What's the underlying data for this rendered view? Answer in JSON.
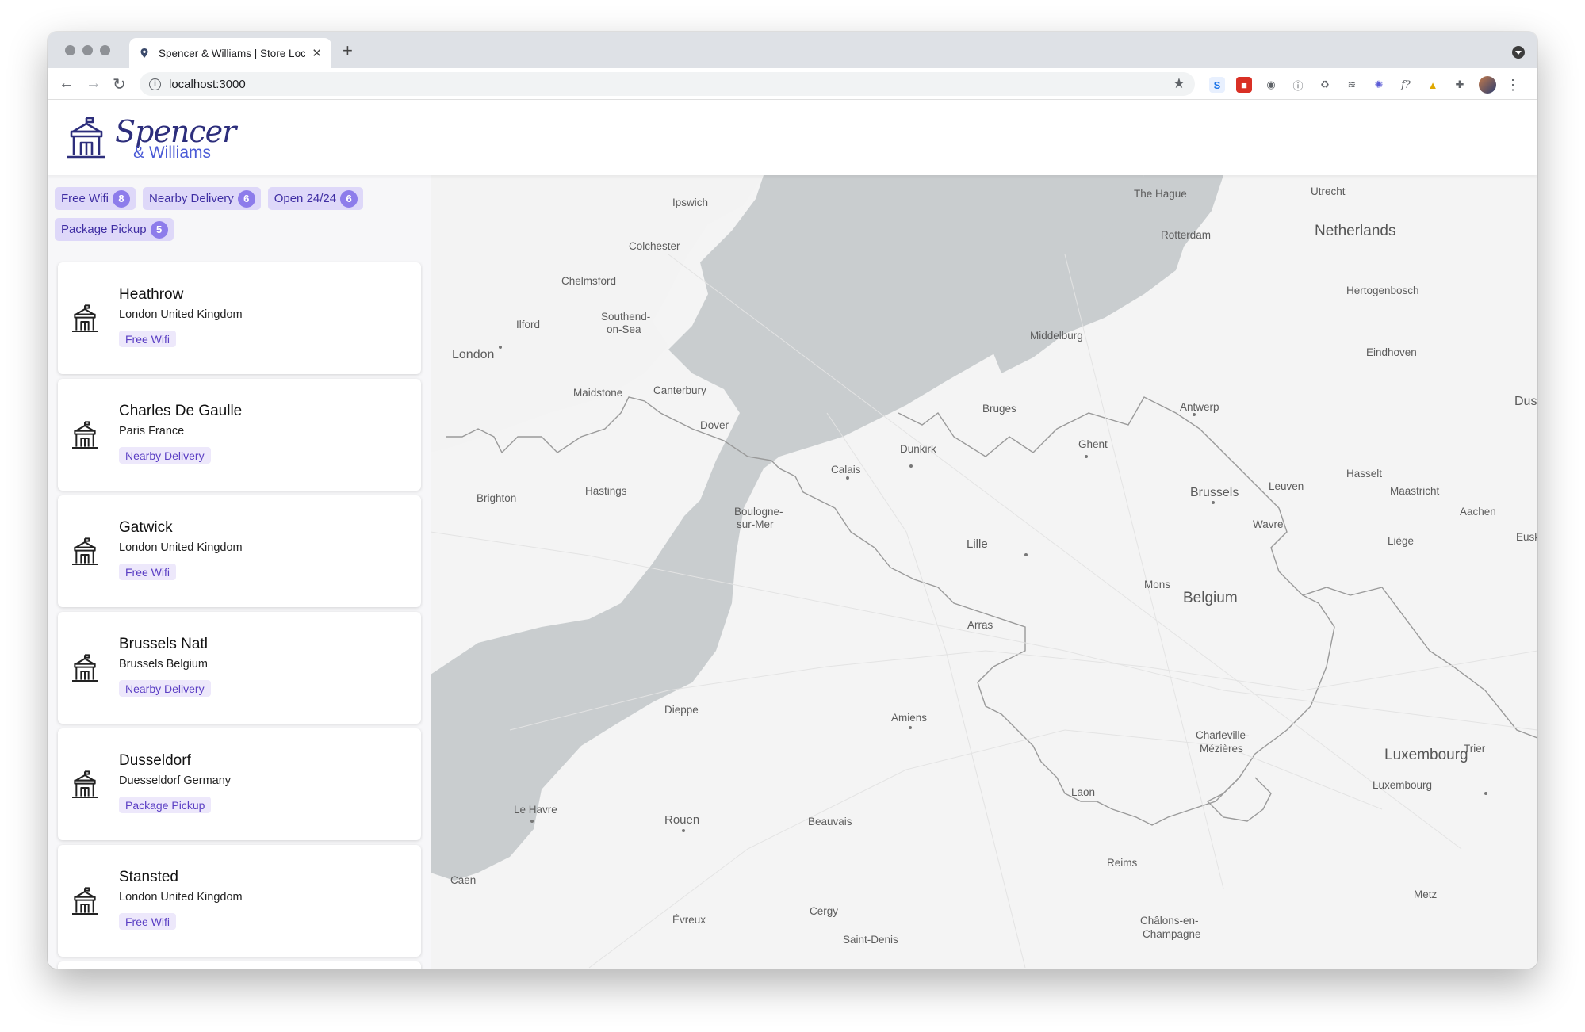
{
  "browser": {
    "tab_title": "Spencer & Williams | Store Loc",
    "url": "localhost:3000"
  },
  "brand": {
    "script": "Spencer",
    "sub": "& Williams"
  },
  "filters": [
    {
      "label": "Free Wifi",
      "count": "8"
    },
    {
      "label": "Nearby Delivery",
      "count": "6"
    },
    {
      "label": "Open 24/24",
      "count": "6"
    },
    {
      "label": "Package Pickup",
      "count": "5"
    }
  ],
  "stores": [
    {
      "name": "Heathrow",
      "location": "London United Kingdom",
      "tag": "Free Wifi"
    },
    {
      "name": "Charles De Gaulle",
      "location": "Paris France",
      "tag": "Nearby Delivery"
    },
    {
      "name": "Gatwick",
      "location": "London United Kingdom",
      "tag": "Free Wifi"
    },
    {
      "name": "Brussels Natl",
      "location": "Brussels Belgium",
      "tag": "Nearby Delivery"
    },
    {
      "name": "Dusseldorf",
      "location": "Duesseldorf Germany",
      "tag": "Package Pickup"
    },
    {
      "name": "Stansted",
      "location": "London United Kingdom",
      "tag": "Free Wifi"
    }
  ],
  "map": {
    "countries": [
      "Netherlands",
      "Belgium",
      "Luxembourg"
    ],
    "cities": [
      "The Hague",
      "Utrecht",
      "Rotterdam",
      "Hertogenbosch",
      "Eindhoven",
      "Middelburg",
      "Antwerp",
      "Bruges",
      "Ghent",
      "Dunkirk",
      "Calais",
      "Brussels",
      "Leuven",
      "Hasselt",
      "Maastricht",
      "Aachen",
      "Wavre",
      "Liège",
      "Lille",
      "Mons",
      "Arras",
      "Amiens",
      "Charleville-",
      "Mézières",
      "Luxembourg",
      "Trier",
      "Laon",
      "Reims",
      "Metz",
      "Châlons-en-",
      "Champagne",
      "Beauvais",
      "Rouen",
      "Le Havre",
      "Caen",
      "Dieppe",
      "Cergy",
      "Saint-Denis",
      "Évreux",
      "Ipswich",
      "Colchester",
      "Chelmsford",
      "Southend-",
      "on-Sea",
      "Ilford",
      "London",
      "Maidstone",
      "Canterbury",
      "Dover",
      "Brighton",
      "Hastings",
      "Boulogne-",
      "sur-Mer",
      "Dusse",
      "Euski"
    ]
  }
}
